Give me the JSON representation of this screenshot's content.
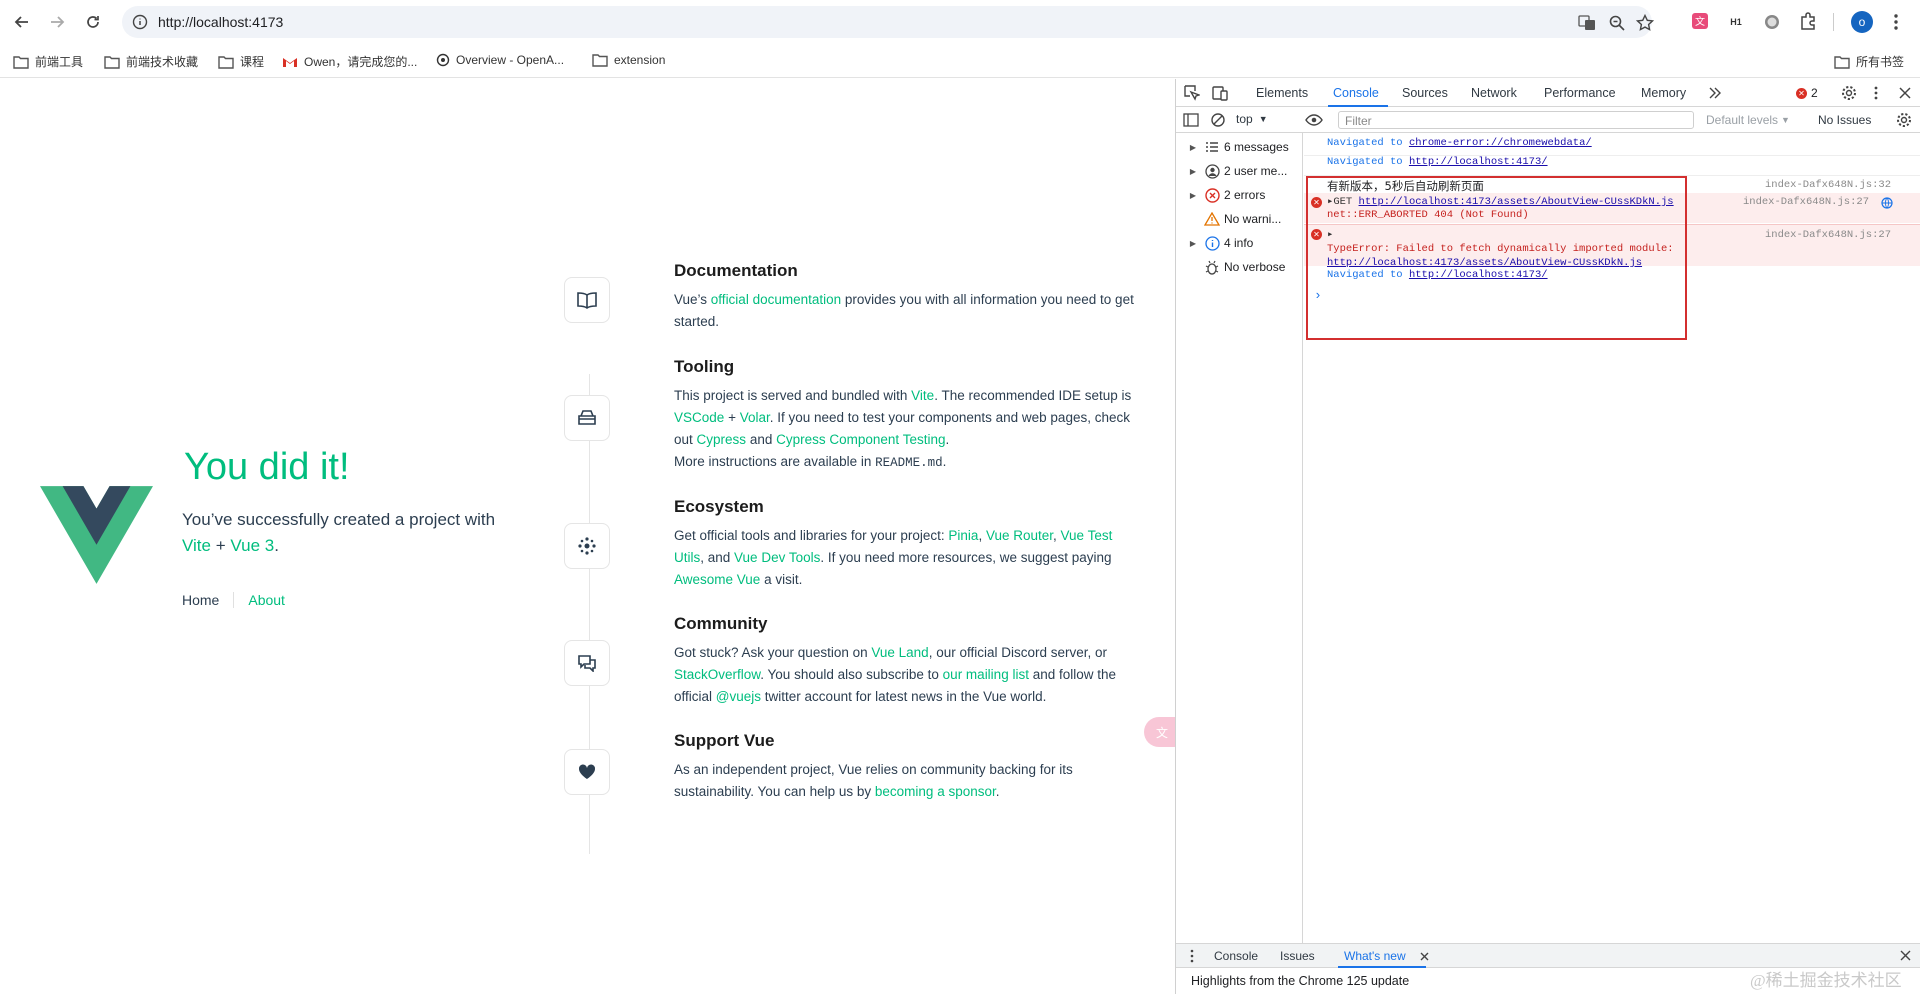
{
  "browser": {
    "url": "http://localhost:4173",
    "bookmarks": [
      "前端工具",
      "前端技术收藏",
      "课程",
      "Owen，请完成您的...",
      "Overview - OpenA...",
      "extension"
    ],
    "all_bookmarks": "所有书签",
    "profile_initial": "o"
  },
  "page": {
    "hero": {
      "title": "You did it!",
      "subtitle_prefix": "You’ve successfully created a project with",
      "vite": "Vite",
      "plus": "+",
      "vue3": "Vue 3",
      "period": "."
    },
    "nav": {
      "home": "Home",
      "about": "About"
    },
    "items": [
      {
        "title": "Documentation"
      },
      {
        "title": "Tooling"
      },
      {
        "title": "Ecosystem"
      },
      {
        "title": "Community"
      },
      {
        "title": "Support Vue"
      }
    ],
    "doc": {
      "a": "Vue’s",
      "link": "official documentation",
      "b": "provides you with all information you need to get started."
    },
    "tool": {
      "a": "This project is served and bundled with",
      "vite": "Vite",
      "b": ". The recommended IDE setup is",
      "vscode": "VSCode",
      "plus": "+",
      "volar": "Volar",
      "c": ". If you need to test your components and web pages, check out",
      "cypress": "Cypress",
      "and": "and",
      "cct": "Cypress Component Testing",
      "d": ".",
      "e": "More instructions are available in",
      "readme": "README.md",
      "f": "."
    },
    "eco": {
      "a": "Get official tools and libraries for your project:",
      "pinia": "Pinia",
      "comma1": ",",
      "router": "Vue Router",
      "comma2": ",",
      "test": "Vue Test Utils",
      "and": ", and",
      "devtools": "Vue Dev Tools",
      "b": ". If you need more resources, we suggest paying",
      "awesome": "Awesome Vue",
      "c": "a visit."
    },
    "comm": {
      "a": "Got stuck? Ask your question on",
      "land": "Vue Land",
      "b": ", our official Discord server, or",
      "so": "StackOverflow",
      "c": ". You should also subscribe to",
      "mail": "our mailing list",
      "d": "and follow the official",
      "vuejs": "@vuejs",
      "e": "twitter account for latest news in the Vue world."
    },
    "support": {
      "a": "As an independent project, Vue relies on community backing for its sustainability. You can help us by",
      "sponsor": "becoming a sponsor",
      "b": "."
    }
  },
  "devtools": {
    "tabs": [
      "Elements",
      "Console",
      "Sources",
      "Network",
      "Performance",
      "Memory"
    ],
    "error_count": "2",
    "context": "top",
    "filter_placeholder": "Filter",
    "levels": "Default levels",
    "issues": "No Issues",
    "sidebar": [
      "6 messages",
      "2 user me...",
      "2 errors",
      "No warni...",
      "4 info",
      "No verbose"
    ],
    "log": {
      "nav1_prefix": "Navigated to",
      "nav1_link": "chrome-error://chromewebdata/",
      "nav2_prefix": "Navigated to",
      "nav2_link": "http://localhost:4173/",
      "msg": "有新版本，5秒后自动刷新页面",
      "msg_src": "index-Dafx648N.js:32",
      "err1_prefix": "GET",
      "err1_link": "http://localhost:4173/assets/AboutView-CUssKDkN.js",
      "err1_line2": "net::ERR_ABORTED 404 (Not Found)",
      "err1_src": "index-Dafx648N.js:27",
      "err2_line1": "TypeError: Failed to fetch dynamically imported module:",
      "err2_link": "http://localhost:4173/assets/AboutView-CUssKDkN.js",
      "err2_src": "index-Dafx648N.js:27",
      "nav3_prefix": "Navigated to",
      "nav3_link": "http://localhost:4173/",
      "prompt": "›"
    },
    "drawer": {
      "tabs": [
        "Console",
        "Issues",
        "What's new"
      ],
      "text": "Highlights from the Chrome 125 update"
    }
  },
  "watermark": "@稀土掘金技术社区"
}
